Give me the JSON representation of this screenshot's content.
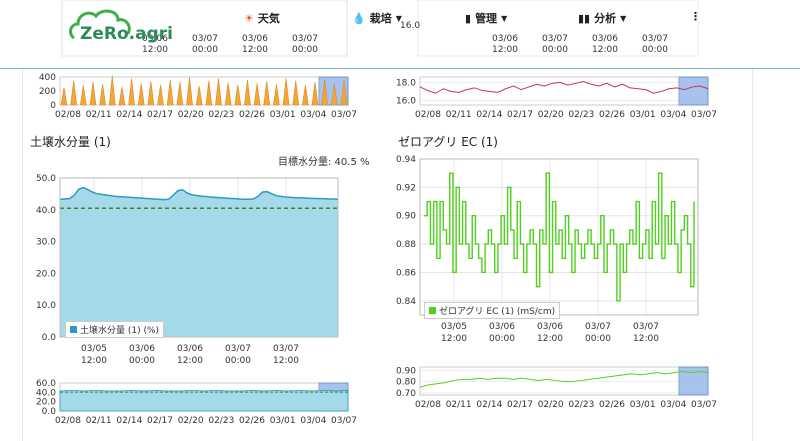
{
  "nav": {
    "logo_text": "ZeRo.agri",
    "weather": "天気",
    "cultivation": "栽培",
    "management": "管理",
    "analysis": "分析",
    "more": "⋮"
  },
  "top_strip": {
    "left_ticks": [
      "03/06",
      "03/07",
      "03/06",
      "03/07"
    ],
    "left_times": [
      "12:00",
      "00:00",
      "12:00",
      "00:00"
    ],
    "right_ticks": [
      "03/06",
      "03/07",
      "03/06",
      "03/07"
    ],
    "right_times": [
      "12:00",
      "00:00",
      "12:00",
      "00:00"
    ],
    "right_y": "16.0"
  },
  "left_panel": {
    "title": "土壌水分量 (1)",
    "target_label": "目標水分量: 40.5 %",
    "legend": "土壌水分量 (1) (%)",
    "colors": {
      "fill": "#a5d8e8",
      "line": "#2a9cbf",
      "target": "#2e8b2e",
      "nav": "#e8a030",
      "selection": "#8ab0e8"
    }
  },
  "right_panel": {
    "title": "ゼロアグリ EC (1)",
    "legend": "ゼロアグリ EC (1) (mS/cm)",
    "colors": {
      "line": "#4fd11e",
      "nav_top": "#c8344c"
    }
  },
  "nav_axis_dates": [
    "02/08",
    "02/11",
    "02/14",
    "02/17",
    "02/20",
    "02/23",
    "02/26",
    "03/01",
    "03/04",
    "03/07"
  ],
  "chart_data": [
    {
      "type": "area",
      "title": "土壌水分量 (1)",
      "ylabel": "",
      "ylim": [
        0,
        50
      ],
      "yticks": [
        "50.0",
        "40.0",
        "30.0",
        "20.0",
        "10.0",
        "0.0"
      ],
      "x_ticks": [
        [
          "03/05",
          "12:00"
        ],
        [
          "03/06",
          "00:00"
        ],
        [
          "03/06",
          "12:00"
        ],
        [
          "03/07",
          "00:00"
        ],
        [
          "03/07",
          "12:00"
        ]
      ],
      "target": 40.5,
      "series": [
        {
          "name": "土壌水分量 (1) (%)",
          "values": [
            43.3,
            43.4,
            43.5,
            44.5,
            46.5,
            47.0,
            46.3,
            45.5,
            45.0,
            44.8,
            44.6,
            44.4,
            44.2,
            44.1,
            44.0,
            43.9,
            43.8,
            43.7,
            43.6,
            43.5,
            43.4,
            43.3,
            43.2,
            43.3,
            44.5,
            46.0,
            46.3,
            45.3,
            44.7,
            44.5,
            44.3,
            44.2,
            44.0,
            43.9,
            43.8,
            43.7,
            43.6,
            43.5,
            43.4,
            43.3,
            43.3,
            43.4,
            44.2,
            45.6,
            45.7,
            45.0,
            44.4,
            44.2,
            44.0,
            43.9,
            43.8,
            43.8,
            43.7,
            43.6,
            43.6,
            43.5,
            43.5,
            43.4,
            43.4,
            43.3
          ]
        }
      ]
    },
    {
      "type": "line",
      "title": "ゼロアグリ EC (1)",
      "ylabel": "",
      "ylim": [
        0.83,
        0.94
      ],
      "yticks": [
        "0.94",
        "0.92",
        "0.90",
        "0.88",
        "0.86",
        "0.84"
      ],
      "x_ticks": [
        [
          "03/05",
          "12:00"
        ],
        [
          "03/06",
          "00:00"
        ],
        [
          "03/06",
          "12:00"
        ],
        [
          "03/07",
          "00:00"
        ],
        [
          "03/07",
          "12:00"
        ]
      ],
      "series": [
        {
          "name": "ゼロアグリ EC (1) (mS/cm)",
          "values": [
            0.9,
            0.91,
            0.88,
            0.91,
            0.87,
            0.91,
            0.89,
            0.88,
            0.93,
            0.86,
            0.92,
            0.88,
            0.91,
            0.88,
            0.87,
            0.9,
            0.88,
            0.87,
            0.86,
            0.88,
            0.89,
            0.88,
            0.86,
            0.88,
            0.9,
            0.88,
            0.92,
            0.89,
            0.87,
            0.91,
            0.88,
            0.86,
            0.88,
            0.89,
            0.88,
            0.85,
            0.89,
            0.88,
            0.93,
            0.86,
            0.91,
            0.88,
            0.89,
            0.87,
            0.9,
            0.88,
            0.86,
            0.89,
            0.88,
            0.87,
            0.88,
            0.89,
            0.88,
            0.87,
            0.88,
            0.9,
            0.86,
            0.88,
            0.89,
            0.88,
            0.84,
            0.88,
            0.86,
            0.88,
            0.89,
            0.88,
            0.91,
            0.87,
            0.88,
            0.89,
            0.87,
            0.91,
            0.88,
            0.93,
            0.87,
            0.9,
            0.88,
            0.91,
            0.88,
            0.86,
            0.89,
            0.9,
            0.88,
            0.85,
            0.91
          ]
        }
      ]
    },
    {
      "type": "bar",
      "title": "",
      "ylim": [
        0,
        400
      ],
      "yticks": [
        "400",
        "200",
        "0"
      ],
      "categories": [
        "02/08",
        "02/11",
        "02/14",
        "02/17",
        "02/20",
        "02/23",
        "02/26",
        "03/01",
        "03/04",
        "03/07"
      ],
      "values": [
        250,
        350,
        280,
        330,
        300,
        420,
        260,
        380,
        310,
        340,
        290,
        360,
        330,
        400,
        270,
        350,
        380,
        320,
        290,
        360,
        310,
        340,
        300,
        380,
        350,
        290,
        330,
        370,
        300,
        360
      ]
    },
    {
      "type": "line",
      "title": "",
      "ylim": [
        15.5,
        18.6
      ],
      "yticks": [
        "18.0",
        "16.0"
      ],
      "categories": [
        "02/08",
        "02/11",
        "02/14",
        "02/17",
        "02/20",
        "02/23",
        "02/26",
        "03/01",
        "03/04",
        "03/07"
      ],
      "values": [
        17.5,
        17.1,
        16.8,
        17.3,
        17.0,
        16.9,
        17.2,
        17.4,
        17.1,
        17.0,
        16.9,
        17.3,
        17.6,
        17.2,
        17.5,
        17.8,
        17.6,
        17.9,
        18.0,
        17.7,
        17.9,
        18.1,
        17.8,
        17.6,
        17.9,
        17.5,
        17.8,
        17.4,
        17.3,
        17.2,
        16.8,
        17.0,
        17.3,
        17.4,
        17.2,
        17.5,
        17.6,
        17.3
      ]
    },
    {
      "type": "area",
      "title": "",
      "ylim": [
        0,
        60
      ],
      "yticks": [
        "60.0",
        "40.0",
        "20.0",
        "0.0"
      ],
      "categories": [
        "02/08",
        "02/11",
        "02/14",
        "02/17",
        "02/20",
        "02/23",
        "02/26",
        "03/01",
        "03/04",
        "03/07"
      ],
      "values": [
        43,
        44,
        43,
        44,
        43,
        43,
        44,
        43,
        44,
        43,
        43,
        44,
        43,
        44,
        43,
        43,
        44,
        43,
        44,
        43,
        44,
        43,
        44,
        43,
        44
      ]
    },
    {
      "type": "line",
      "title": "",
      "ylim": [
        0.68,
        0.93
      ],
      "yticks": [
        "0.90",
        "0.80",
        "0.70"
      ],
      "categories": [
        "02/08",
        "02/11",
        "02/14",
        "02/17",
        "02/20",
        "02/23",
        "02/26",
        "03/01",
        "03/04",
        "03/07"
      ],
      "values": [
        0.75,
        0.77,
        0.78,
        0.79,
        0.81,
        0.82,
        0.82,
        0.83,
        0.82,
        0.83,
        0.83,
        0.82,
        0.83,
        0.82,
        0.81,
        0.82,
        0.81,
        0.8,
        0.8,
        0.81,
        0.82,
        0.83,
        0.84,
        0.85,
        0.86,
        0.87,
        0.86,
        0.87,
        0.88,
        0.87,
        0.88,
        0.89,
        0.88,
        0.89,
        0.88
      ]
    }
  ]
}
